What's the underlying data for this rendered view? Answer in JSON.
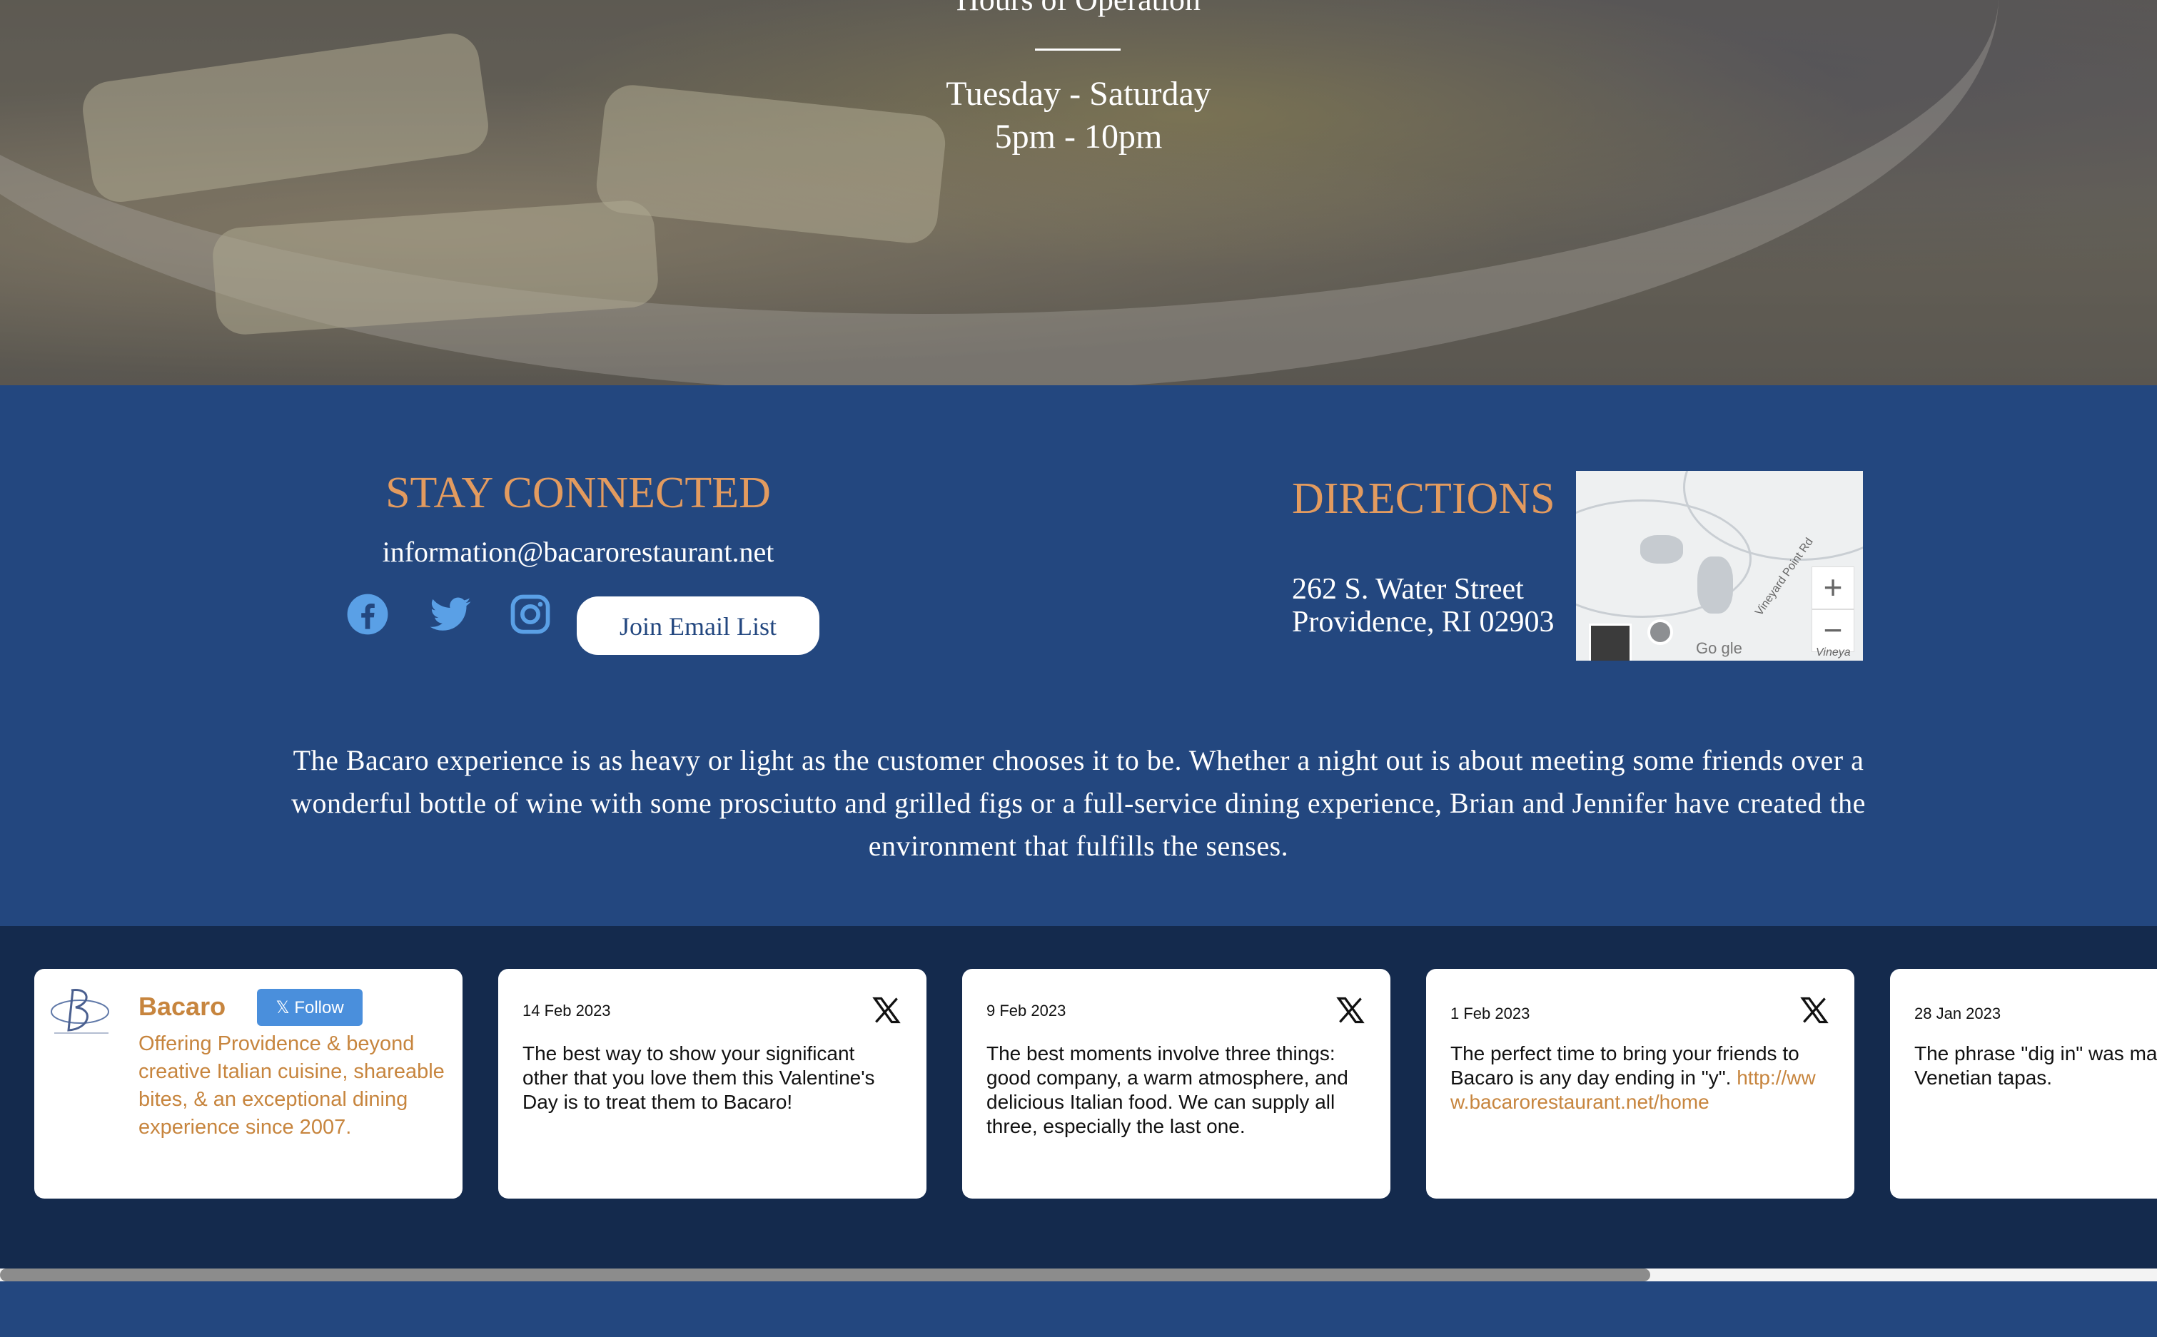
{
  "hero": {
    "hours_title": "Hours of Operation",
    "days": "Tuesday - Saturday",
    "time": "5pm - 10pm"
  },
  "connect": {
    "title": "STAY CONNECTED",
    "email": "information@bacarorestaurant.net",
    "social_icons": [
      "facebook-icon",
      "twitter-icon",
      "instagram-icon"
    ],
    "join_label": "Join Email List"
  },
  "directions": {
    "title": "DIRECTIONS",
    "address_line1": "262 S. Water Street",
    "address_line2": "Providence, RI 02903",
    "map": {
      "zoom_in": "+",
      "zoom_out": "−",
      "google_label": "Go  gle",
      "street_label": "Vineyard Point Rd",
      "corner_label": "Vineya"
    }
  },
  "blurb": "The Bacaro experience is as heavy or light as the customer chooses it to be. Whether a night out is about meeting some friends over a wonderful bottle of wine with some prosciutto and grilled figs or a full-service dining experience, Brian and Jennifer have created the environment that fulfills the senses.",
  "feed": {
    "profile": {
      "name": "Bacaro",
      "follow_label": "Follow",
      "bio": "Offering Providence & beyond creative Italian cuisine, shareable bites, & an exceptional dining experience since 2007."
    },
    "posts": [
      {
        "date": "14 Feb 2023",
        "text": "The best way to show your significant other that you love them this Valentine's Day is to treat them to Bacaro!"
      },
      {
        "date": "9 Feb 2023",
        "text": "The best moments involve three things: good company, a warm atmosphere, and delicious Italian food. We can supply all three, especially the last one."
      },
      {
        "date": "1 Feb 2023",
        "text": "The perfect time to bring your friends to Bacaro is any day ending in \"y\".",
        "link": "http://www.bacarorestaurant.net/home"
      },
      {
        "date": "28 Jan 2023",
        "text": "The phrase \"dig in\" was ma Venetian tapas."
      }
    ]
  },
  "colors": {
    "section_blue": "#23477f",
    "feed_navy": "#142a4d",
    "accent_orange": "#e39b5f",
    "link_orange": "#c7853e",
    "social_blue": "#5aa0e6"
  }
}
